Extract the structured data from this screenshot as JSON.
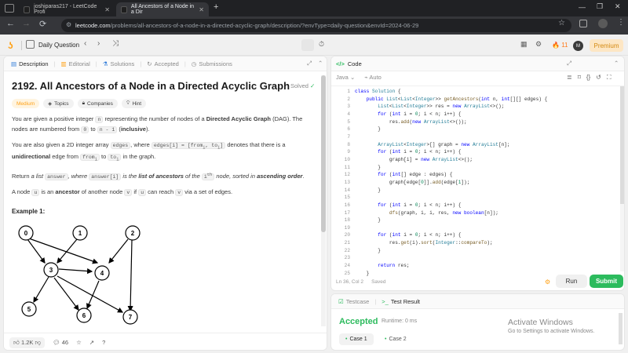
{
  "browser": {
    "tabs": [
      {
        "label": "joshiparas217 - LeetCode Profi"
      },
      {
        "label": "All Ancestors of a Node in a Dir"
      }
    ],
    "url_host": "leetcode.com",
    "url_path": "/problems/all-ancestors-of-a-node-in-a-directed-acyclic-graph/description/?envType=daily-question&envId=2024-06-29"
  },
  "topbar": {
    "daily_question": "Daily Question",
    "streak": "11",
    "avatar": "M",
    "premium": "Premium"
  },
  "left_tabs": [
    "Description",
    "Editorial",
    "Solutions",
    "Accepted",
    "Submissions"
  ],
  "problem": {
    "title": "2192. All Ancestors of a Node in a Directed Acyclic Graph",
    "status": "Solved",
    "tags": [
      "Medium",
      "Topics",
      "Companies",
      "Hint"
    ],
    "p1a": "You are given a positive integer ",
    "p1n": "n",
    "p1b": " representing the number of nodes of a ",
    "p1bold": "Directed Acyclic Graph",
    "p1c": " (DAG). The nodes are numbered from ",
    "p1code1": "0",
    "p1d": " to ",
    "p1code2": "n - 1",
    "p1e": " (",
    "p1bold2": "inclusive",
    "p1f": ").",
    "p2a": "You are also given a 2D integer array ",
    "p2code1": "edges",
    "p2b": ", where ",
    "p2code2": "edges[i] = [from",
    "p2sub": "i",
    "p2code2b": ", to",
    "p2code2c": "]",
    "p2c": " denotes that there is a ",
    "p2bold": "unidirectional",
    "p2d": " edge from ",
    "p2code3": "from",
    "p2e": " to ",
    "p2code4": "to",
    "p2f": " in the graph.",
    "p3a": "Return ",
    "p3i": "a list",
    "p3code1": "answer",
    "p3b": ", where ",
    "p3code2": "answer[i]",
    "p3c": " is the ",
    "p3bold": "list of ancestors",
    "p3d": " of the ",
    "p3code3": "i",
    "p3sup": "th",
    "p3e": " node, sorted in ",
    "p3bold2": "ascending order",
    "p3f": ".",
    "p4a": "A node ",
    "p4code1": "u",
    "p4b": " is an ",
    "p4bold": "ancestor",
    "p4c": " of another node ",
    "p4code2": "v",
    "p4d": " if ",
    "p4code3": "u",
    "p4e": " can reach ",
    "p4code4": "v",
    "p4f": " via a set of edges.",
    "example": "Example 1:",
    "graph_nodes": [
      "0",
      "1",
      "2",
      "3",
      "4",
      "5",
      "6",
      "7"
    ]
  },
  "bottom_left": {
    "likes": "1.2K",
    "comments": "46"
  },
  "code_panel": {
    "title": "Code",
    "language": "Java",
    "auto": "Auto",
    "status": "Ln 36, Col 2",
    "saved": "Saved",
    "run": "Run",
    "submit": "Submit"
  },
  "code_lines": [
    "1",
    "2",
    "3",
    "4",
    "5",
    "6",
    "7",
    "8",
    "9",
    "10",
    "11",
    "12",
    "13",
    "14",
    "15",
    "16",
    "17",
    "18",
    "19",
    "20",
    "21",
    "22",
    "23",
    "24",
    "25"
  ],
  "result_panel": {
    "testcase_tab": "Testcase",
    "result_tab": "Test Result",
    "verdict": "Accepted",
    "runtime": "Runtime: 0 ms",
    "cases": [
      "Case 1",
      "Case 2"
    ]
  },
  "watermark": {
    "title": "Activate Windows",
    "subtitle": "Go to Settings to activate Windows."
  }
}
